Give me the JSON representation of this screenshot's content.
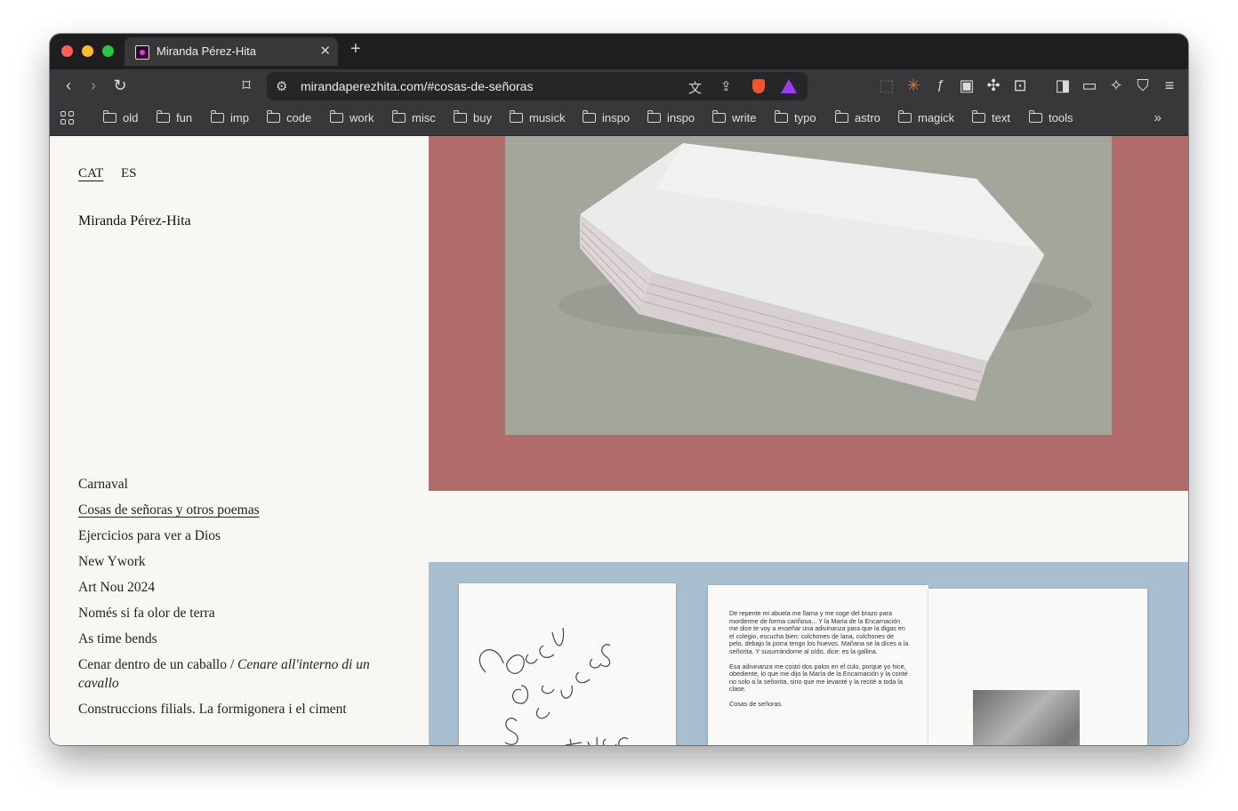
{
  "browser": {
    "tab": {
      "title": "Miranda Pérez-Hita",
      "close_icon": "close-icon"
    },
    "new_tab_icon": "plus-icon",
    "url": "mirandaperezhita.com/#cosas-de-señoras",
    "bookmarks": [
      "old",
      "fun",
      "imp",
      "code",
      "work",
      "misc",
      "buy",
      "musick",
      "inspo",
      "inspo",
      "write",
      "typo",
      "astro",
      "magick",
      "text",
      "tools"
    ],
    "colors": {
      "chrome": "#38383b",
      "tabstrip": "#1e1e21",
      "urlbar": "#262628"
    }
  },
  "site": {
    "lang": {
      "cat": "CAT",
      "es": "ES"
    },
    "name": "Miranda Pérez-Hita",
    "works": [
      {
        "title": "Carnaval"
      },
      {
        "title": "Cosas de señoras y otros poemas",
        "active": true
      },
      {
        "title": "Ejercicios para ver a Dios"
      },
      {
        "title": "New Ywork"
      },
      {
        "title": "Art Nou 2024"
      },
      {
        "title": "Només si fa olor de terra"
      },
      {
        "title": "As time bends"
      },
      {
        "title": "Cenar dentro de un caballo / ",
        "title_italic": "Cenare all'interno di un cavallo"
      },
      {
        "title": "Construccions filials. La formigonera i el ciment"
      }
    ],
    "image2": {
      "handwriting": "Cosas de señoras y otros",
      "page_text_1": "De repente mi abuela me llama y me coge del brazo para morderme de forma cariñosa... Y la María de la Encarnación me dice te voy a enseñar una adivinanza para que la digas en el colegio, escucha bien: colchones de lana, colchones de pelo, debajo la porra tengo los huevos. Mañana se la dices a la señorita. Y susurrándome al oído, dice: es la gallina.",
      "page_text_2": "Esa adivinanza me costó dos palos en el culo, porque yo hice, obediente, lo que me dijo la María de la Encarnación y la conté no solo a la señorita, sino que me levanté y la recité a toda la clase.",
      "page_text_3": "Cosas de señoras."
    },
    "colors": {
      "background": "#f8f7f4",
      "image1_frame": "#b06b6b",
      "image2_frame": "#a8bfd0"
    }
  }
}
